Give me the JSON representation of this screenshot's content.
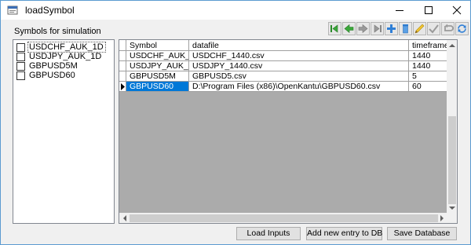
{
  "window": {
    "title": "loadSymbol"
  },
  "symbols_panel": {
    "label": "Symbols for simulation",
    "items": [
      {
        "label": "USDCHF_AUK_1D",
        "checked": false
      },
      {
        "label": "USDJPY_AUK_1D",
        "checked": false
      },
      {
        "label": "GBPUSD5M",
        "checked": false
      },
      {
        "label": "GBPUSD60",
        "checked": false
      }
    ]
  },
  "toolbar": {
    "icons": [
      "first-icon",
      "prev-icon",
      "next-icon",
      "last-icon",
      "add-icon",
      "delete-icon",
      "edit-icon",
      "post-icon",
      "cancel-icon",
      "refresh-icon"
    ]
  },
  "grid": {
    "columns": [
      "Symbol",
      "datafile",
      "timeframe"
    ],
    "rows": [
      [
        "USDCHF_AUK_1D",
        "USDCHF_1440.csv",
        "1440"
      ],
      [
        "USDJPY_AUK_1D",
        "USDJPY_1440.csv",
        "1440"
      ],
      [
        "GBPUSD5M",
        "GBPUSD5.csv",
        "5"
      ],
      [
        "GBPUSD60",
        "D:\\Program Files (x86)\\OpenKantu\\GBPUSD60.csv",
        "60"
      ]
    ],
    "current_row": 3
  },
  "buttons": {
    "load": "Load Inputs",
    "add": "Add new entry to DB",
    "save": "Save Database"
  },
  "colors": {
    "selection": "#0078d7",
    "nav_green": "#3aa83a",
    "add_blue": "#2f7fd6"
  }
}
